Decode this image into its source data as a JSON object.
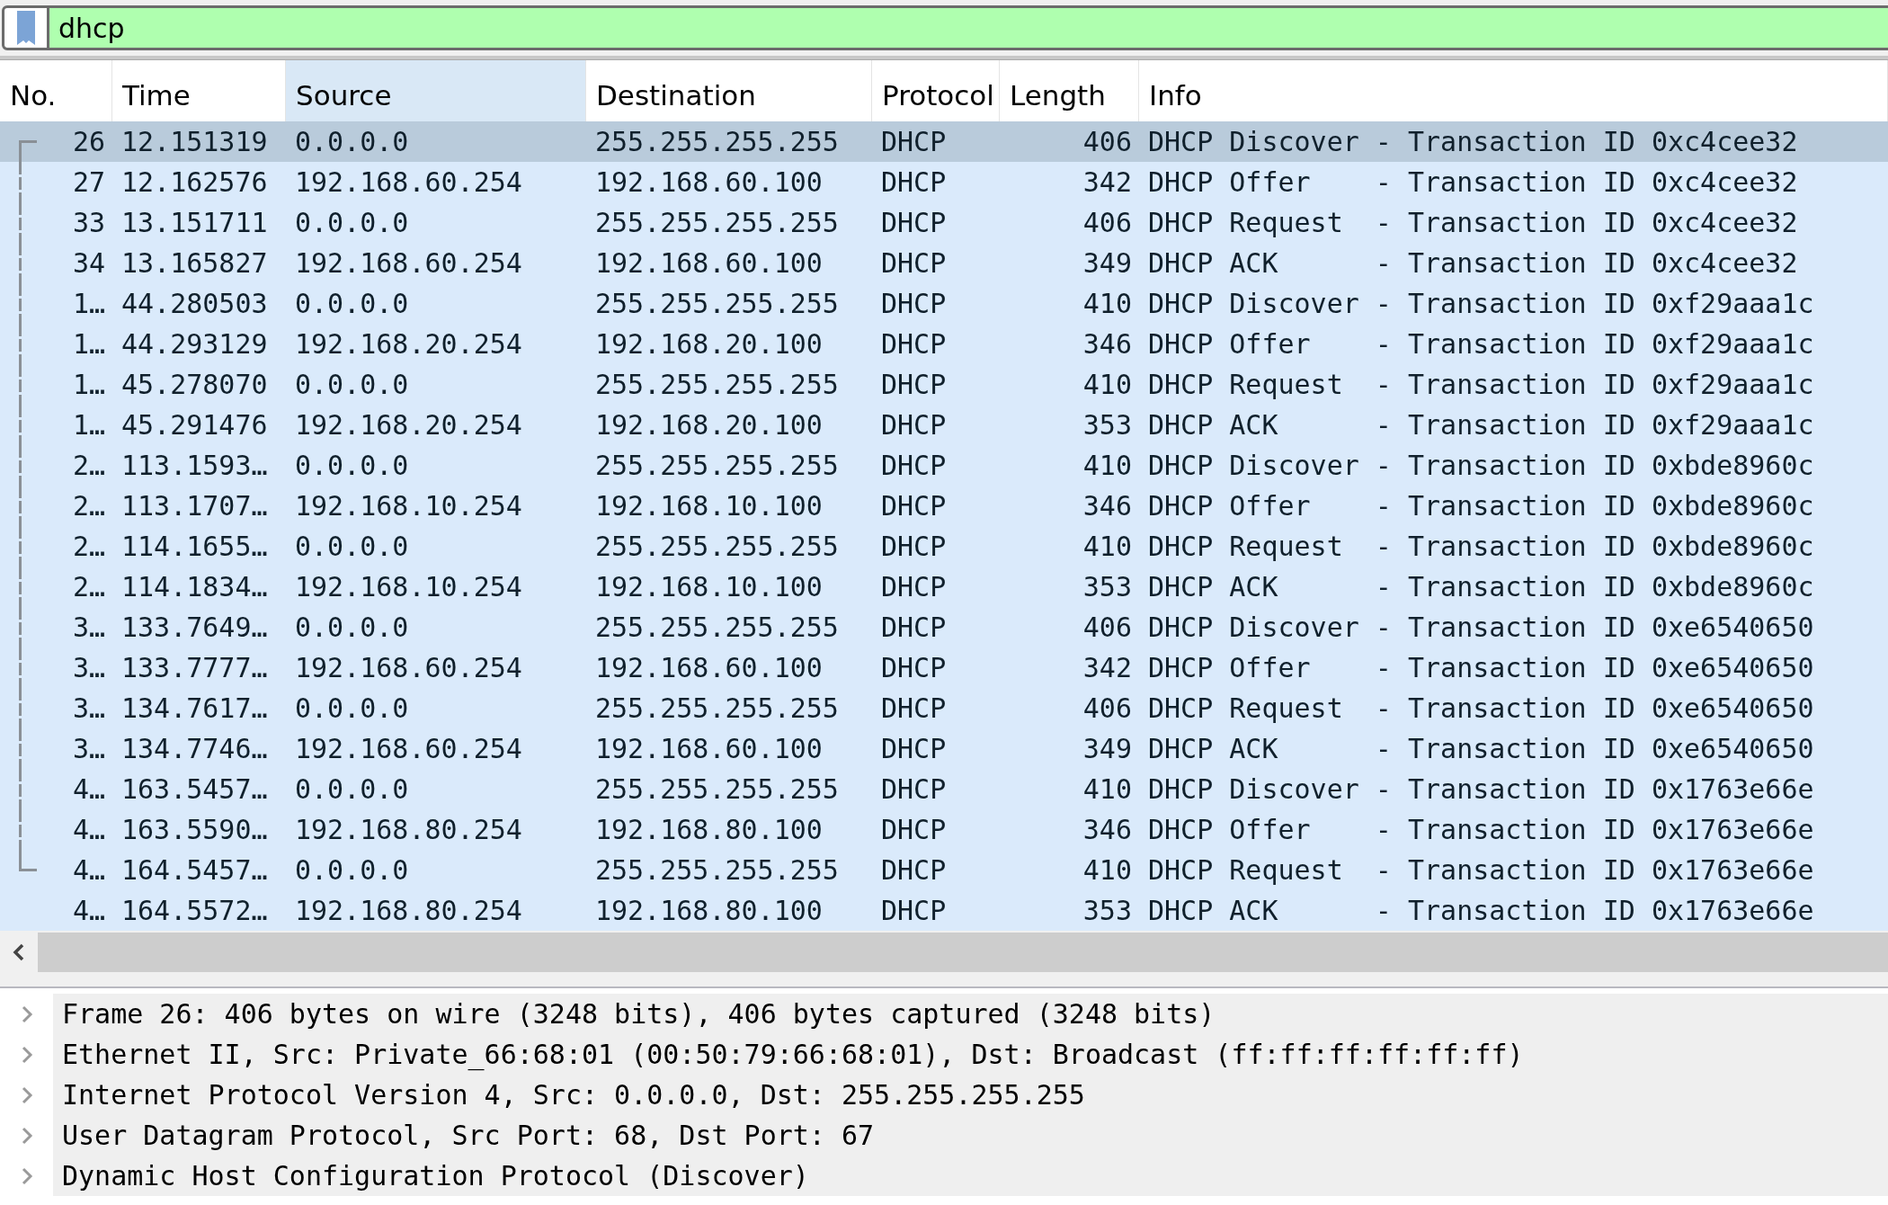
{
  "filter": {
    "value": "dhcp"
  },
  "table": {
    "columns": [
      {
        "label": "No.",
        "selected": false
      },
      {
        "label": "Time",
        "selected": false
      },
      {
        "label": "Source",
        "selected": true
      },
      {
        "label": "Destination",
        "selected": false
      },
      {
        "label": "Protocol",
        "selected": false
      },
      {
        "label": "Length",
        "selected": false
      },
      {
        "label": "Info",
        "selected": false
      }
    ],
    "rows": [
      {
        "selected": true,
        "related": true,
        "cells": [
          "26",
          "12.151319",
          "0.0.0.0",
          "255.255.255.255",
          "DHCP",
          "406",
          "DHCP Discover - Transaction ID 0xc4cee32"
        ]
      },
      {
        "selected": false,
        "related": true,
        "cells": [
          "27",
          "12.162576",
          "192.168.60.254",
          "192.168.60.100",
          "DHCP",
          "342",
          "DHCP Offer    - Transaction ID 0xc4cee32"
        ]
      },
      {
        "selected": false,
        "related": true,
        "cells": [
          "33",
          "13.151711",
          "0.0.0.0",
          "255.255.255.255",
          "DHCP",
          "406",
          "DHCP Request  - Transaction ID 0xc4cee32"
        ]
      },
      {
        "selected": false,
        "related": true,
        "cells": [
          "34",
          "13.165827",
          "192.168.60.254",
          "192.168.60.100",
          "DHCP",
          "349",
          "DHCP ACK      - Transaction ID 0xc4cee32"
        ]
      },
      {
        "selected": false,
        "related": true,
        "cells": [
          "1…",
          "44.280503",
          "0.0.0.0",
          "255.255.255.255",
          "DHCP",
          "410",
          "DHCP Discover - Transaction ID 0xf29aaa1c"
        ]
      },
      {
        "selected": false,
        "related": true,
        "cells": [
          "1…",
          "44.293129",
          "192.168.20.254",
          "192.168.20.100",
          "DHCP",
          "346",
          "DHCP Offer    - Transaction ID 0xf29aaa1c"
        ]
      },
      {
        "selected": false,
        "related": true,
        "cells": [
          "1…",
          "45.278070",
          "0.0.0.0",
          "255.255.255.255",
          "DHCP",
          "410",
          "DHCP Request  - Transaction ID 0xf29aaa1c"
        ]
      },
      {
        "selected": false,
        "related": true,
        "cells": [
          "1…",
          "45.291476",
          "192.168.20.254",
          "192.168.20.100",
          "DHCP",
          "353",
          "DHCP ACK      - Transaction ID 0xf29aaa1c"
        ]
      },
      {
        "selected": false,
        "related": true,
        "cells": [
          "2…",
          "113.1593…",
          "0.0.0.0",
          "255.255.255.255",
          "DHCP",
          "410",
          "DHCP Discover - Transaction ID 0xbde8960c"
        ]
      },
      {
        "selected": false,
        "related": true,
        "cells": [
          "2…",
          "113.1707…",
          "192.168.10.254",
          "192.168.10.100",
          "DHCP",
          "346",
          "DHCP Offer    - Transaction ID 0xbde8960c"
        ]
      },
      {
        "selected": false,
        "related": true,
        "cells": [
          "2…",
          "114.1655…",
          "0.0.0.0",
          "255.255.255.255",
          "DHCP",
          "410",
          "DHCP Request  - Transaction ID 0xbde8960c"
        ]
      },
      {
        "selected": false,
        "related": true,
        "cells": [
          "2…",
          "114.1834…",
          "192.168.10.254",
          "192.168.10.100",
          "DHCP",
          "353",
          "DHCP ACK      - Transaction ID 0xbde8960c"
        ]
      },
      {
        "selected": false,
        "related": true,
        "cells": [
          "3…",
          "133.7649…",
          "0.0.0.0",
          "255.255.255.255",
          "DHCP",
          "406",
          "DHCP Discover - Transaction ID 0xe6540650"
        ]
      },
      {
        "selected": false,
        "related": true,
        "cells": [
          "3…",
          "133.7777…",
          "192.168.60.254",
          "192.168.60.100",
          "DHCP",
          "342",
          "DHCP Offer    - Transaction ID 0xe6540650"
        ]
      },
      {
        "selected": false,
        "related": true,
        "cells": [
          "3…",
          "134.7617…",
          "0.0.0.0",
          "255.255.255.255",
          "DHCP",
          "406",
          "DHCP Request  - Transaction ID 0xe6540650"
        ]
      },
      {
        "selected": false,
        "related": true,
        "cells": [
          "3…",
          "134.7746…",
          "192.168.60.254",
          "192.168.60.100",
          "DHCP",
          "349",
          "DHCP ACK      - Transaction ID 0xe6540650"
        ]
      },
      {
        "selected": false,
        "related": true,
        "cells": [
          "4…",
          "163.5457…",
          "0.0.0.0",
          "255.255.255.255",
          "DHCP",
          "410",
          "DHCP Discover - Transaction ID 0x1763e66e"
        ]
      },
      {
        "selected": false,
        "related": true,
        "cells": [
          "4…",
          "163.5590…",
          "192.168.80.254",
          "192.168.80.100",
          "DHCP",
          "346",
          "DHCP Offer    - Transaction ID 0x1763e66e"
        ]
      },
      {
        "selected": false,
        "related": true,
        "cells": [
          "4…",
          "164.5457…",
          "0.0.0.0",
          "255.255.255.255",
          "DHCP",
          "410",
          "DHCP Request  - Transaction ID 0x1763e66e"
        ]
      },
      {
        "selected": false,
        "related": false,
        "cells": [
          "4…",
          "164.5572…",
          "192.168.80.254",
          "192.168.80.100",
          "DHCP",
          "353",
          "DHCP ACK      - Transaction ID 0x1763e66e"
        ]
      }
    ]
  },
  "details": [
    {
      "expanded": false,
      "text": "Frame 26: 406 bytes on wire (3248 bits), 406 bytes captured (3248 bits)"
    },
    {
      "expanded": false,
      "text": "Ethernet II, Src: Private_66:68:01 (00:50:79:66:68:01), Dst: Broadcast (ff:ff:ff:ff:ff:ff)"
    },
    {
      "expanded": false,
      "text": "Internet Protocol Version 4, Src: 0.0.0.0, Dst: 255.255.255.255"
    },
    {
      "expanded": false,
      "text": "User Datagram Protocol, Src Port: 68, Dst Port: 67"
    },
    {
      "expanded": false,
      "text": "Dynamic Host Configuration Protocol (Discover)"
    }
  ]
}
